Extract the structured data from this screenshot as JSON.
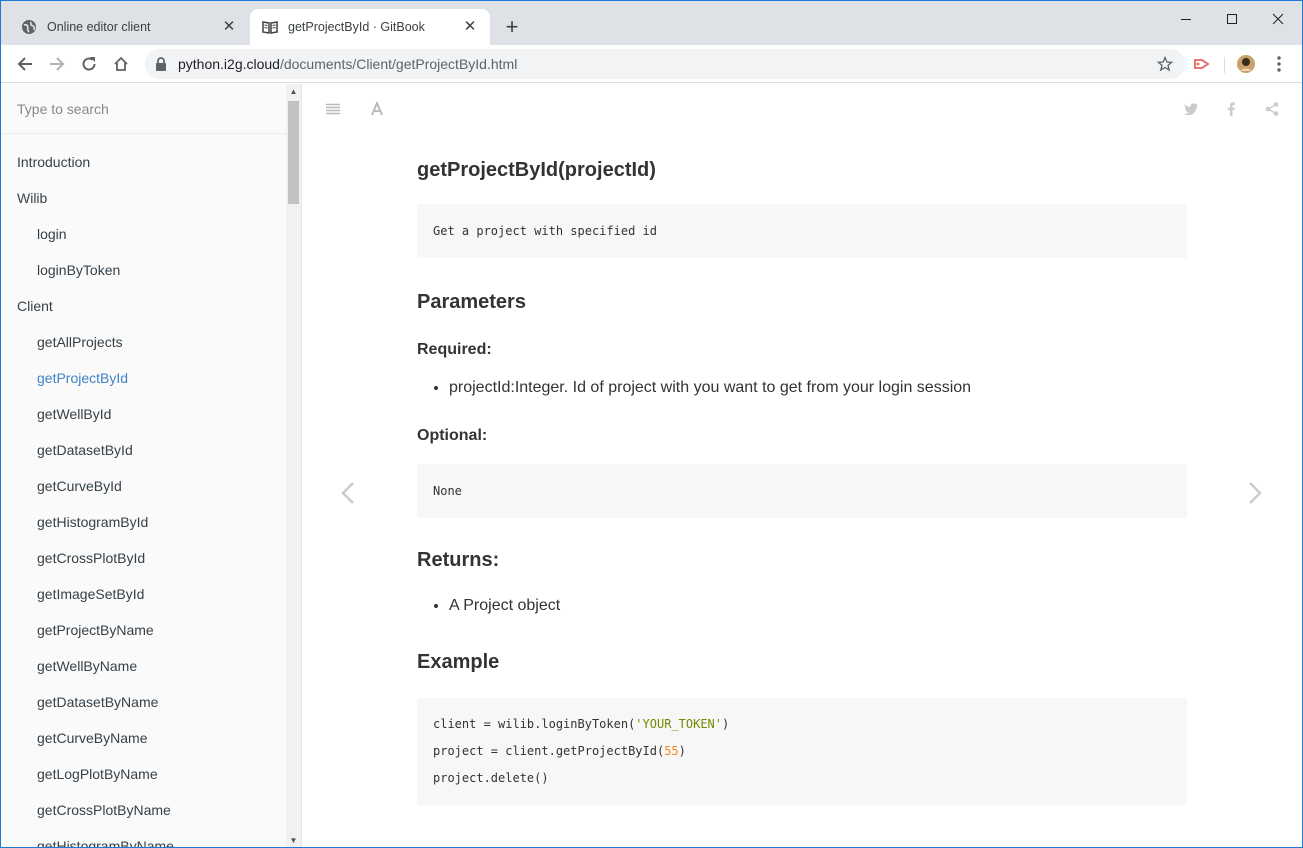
{
  "browser": {
    "tabs": [
      {
        "title": "Online editor client",
        "icon": "globe-icon",
        "active": false
      },
      {
        "title": "getProjectById · GitBook",
        "icon": "book-icon",
        "active": true
      }
    ],
    "new_tab": "+",
    "url_host": "python.i2g.cloud",
    "url_path": "/documents/Client/getProjectById.html"
  },
  "sidebar": {
    "search_placeholder": "Type to search",
    "items": [
      {
        "label": "Introduction",
        "level": 0
      },
      {
        "label": "Wilib",
        "level": 0
      },
      {
        "label": "login",
        "level": 1
      },
      {
        "label": "loginByToken",
        "level": 1
      },
      {
        "label": "Client",
        "level": 0
      },
      {
        "label": "getAllProjects",
        "level": 1
      },
      {
        "label": "getProjectById",
        "level": 1,
        "active": true
      },
      {
        "label": "getWellById",
        "level": 1
      },
      {
        "label": "getDatasetById",
        "level": 1
      },
      {
        "label": "getCurveById",
        "level": 1
      },
      {
        "label": "getHistogramById",
        "level": 1
      },
      {
        "label": "getCrossPlotById",
        "level": 1
      },
      {
        "label": "getImageSetById",
        "level": 1
      },
      {
        "label": "getProjectByName",
        "level": 1
      },
      {
        "label": "getWellByName",
        "level": 1
      },
      {
        "label": "getDatasetByName",
        "level": 1
      },
      {
        "label": "getCurveByName",
        "level": 1
      },
      {
        "label": "getLogPlotByName",
        "level": 1
      },
      {
        "label": "getCrossPlotByName",
        "level": 1
      },
      {
        "label": "getHistogramByName",
        "level": 1
      }
    ]
  },
  "page": {
    "title": "getProjectById(projectId)",
    "description_code": "Get a project with specified id",
    "parameters_heading": "Parameters",
    "required_heading": "Required:",
    "required_items": [
      "projectId:Integer. Id of project with you want to get from your login session"
    ],
    "optional_heading": "Optional:",
    "optional_code": "None",
    "returns_heading": "Returns:",
    "returns_items": [
      "A Project object"
    ],
    "example_heading": "Example",
    "example_code": {
      "line1_a": "client = wilib.loginByToken(",
      "line1_str": "'YOUR_TOKEN'",
      "line1_b": ")",
      "line2_a": "project = client.getProjectById(",
      "line2_num": "55",
      "line2_b": ")",
      "line3": "project.delete()"
    }
  },
  "colors": {
    "active_link": "#4183c4",
    "code_bg": "#f7f7f7",
    "tab_strip": "#dee1e6",
    "window_border": "#1e7ad6"
  }
}
